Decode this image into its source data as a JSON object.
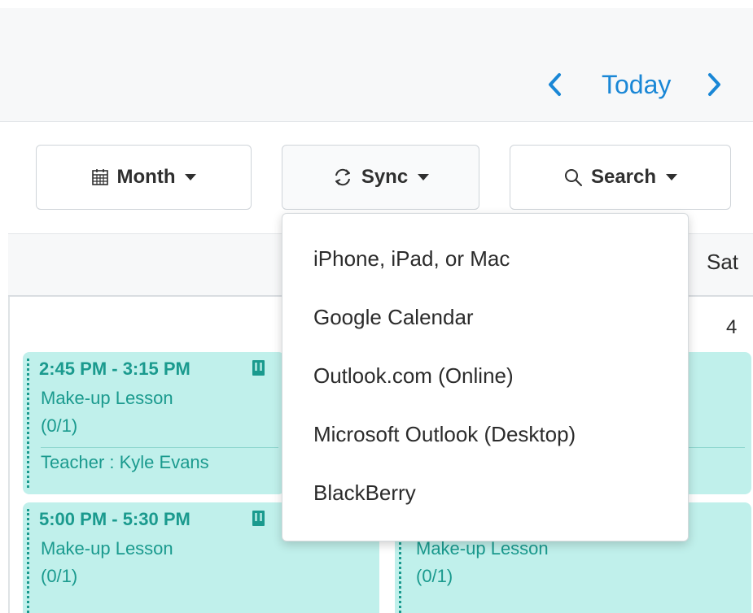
{
  "header": {
    "prev_icon": "chevron-left-icon",
    "today_label": "Today",
    "next_icon": "chevron-right-icon",
    "accent_color": "#1a87d6"
  },
  "toolbar": {
    "month": {
      "icon": "calendar-icon",
      "label": "Month"
    },
    "sync": {
      "icon": "sync-icon",
      "label": "Sync"
    },
    "search": {
      "icon": "search-icon",
      "label": "Search"
    }
  },
  "calendar": {
    "weekday_sat": "Sat",
    "day_number": "4",
    "event_color": "#c0f0eb",
    "event_text_color": "#1a9a8e",
    "events": [
      {
        "time": "2:45 PM - 3:15 PM",
        "title": "Make-up Lesson",
        "count": "(0/1)",
        "teacher": "Teacher : Kyle Evans"
      },
      {
        "time": "5:00 PM - 5:30 PM",
        "title": "Make-up Lesson",
        "count": "(0/1)",
        "teacher": ""
      },
      {
        "time": "",
        "title": "",
        "count": "",
        "teacher": ""
      },
      {
        "time": "",
        "title": "Make-up Lesson",
        "count": "(0/1)",
        "teacher": ""
      }
    ]
  },
  "sync_menu": {
    "items": [
      "iPhone, iPad, or Mac",
      "Google Calendar",
      "Outlook.com (Online)",
      "Microsoft Outlook (Desktop)",
      "BlackBerry"
    ]
  }
}
